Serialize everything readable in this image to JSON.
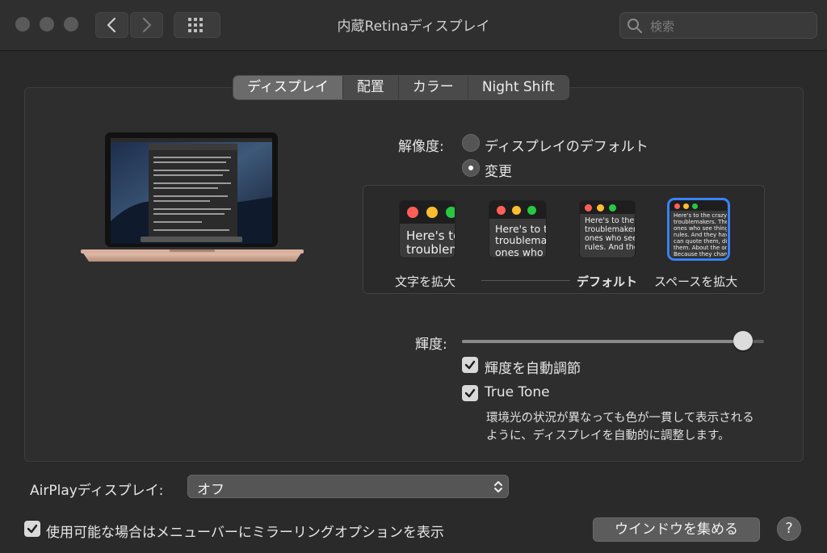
{
  "window": {
    "title": "内蔵Retinaディスプレイ"
  },
  "toolbar": {
    "search_placeholder": "検索"
  },
  "tabs": [
    {
      "label": "ディスプレイ",
      "active": true
    },
    {
      "label": "配置",
      "active": false
    },
    {
      "label": "カラー",
      "active": false
    },
    {
      "label": "Night Shift",
      "active": false
    }
  ],
  "resolution": {
    "label": "解像度:",
    "options": [
      {
        "label": "ディスプレイのデフォルト",
        "selected": false
      },
      {
        "label": "変更",
        "selected": true
      }
    ],
    "scale_labels": {
      "larger_text": "文字を拡大",
      "default": "デフォルト",
      "more_space": "スペースを拡大"
    },
    "thumbs": [
      {
        "text": "Here's to\ntroublem"
      },
      {
        "text": "Here's to t\ntroublema\nones who"
      },
      {
        "text": "Here's to the cr\ntroublemakers.\nones who see t\nrules. And they"
      },
      {
        "text": "Here's to the crazy one\ntroublemakers. The rou\nones who see things di\nrules. And they have no\ncan quote them, disagre\nthem. About the only th\nBecause they change th"
      }
    ],
    "selected_index": 3
  },
  "brightness": {
    "label": "輝度:",
    "level": 0.96,
    "auto_label": "輝度を自動調節",
    "auto_checked": true
  },
  "true_tone": {
    "label": "True Tone",
    "checked": true,
    "description_line1": "環境光の状況が異なっても色が一貫して表示される",
    "description_line2": "ように、ディスプレイを自動的に調整します。"
  },
  "airplay": {
    "label": "AirPlayディスプレイ:",
    "value": "オフ"
  },
  "mirroring": {
    "label": "使用可能な場合はメニューバーにミラーリングオプションを表示",
    "checked": true
  },
  "gather_button": "ウインドウを集める",
  "help_label": "?",
  "colors": {
    "accent": "#3a82f7",
    "close": "#ff5f57",
    "minimize": "#febc2e",
    "zoom": "#28c840"
  }
}
